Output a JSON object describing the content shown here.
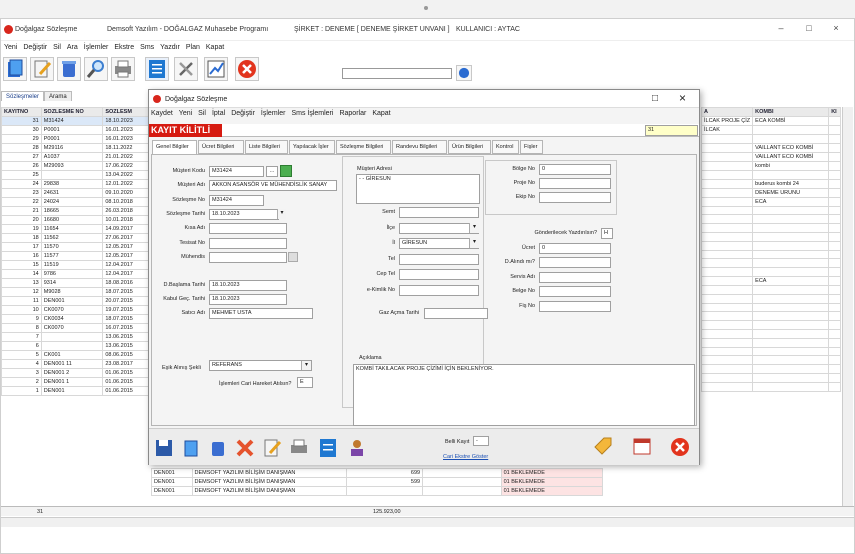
{
  "app": {
    "title_app": "Doğalgaz Sözleşme",
    "title_vendor": "Demsoft Yazılım - DOĞALGAZ Muhasebe Programı",
    "title_company": "ŞİRKET : DENEME [ DENEME ŞİRKET UNVANI ]",
    "title_user": "KULLANICI : AYTAC",
    "minimize": "–",
    "maximize": "□",
    "close": "×"
  },
  "menu": [
    "Yeni",
    "Değiştir",
    "Sil",
    "Ara",
    "İşlemler",
    "Ekstre",
    "Sms",
    "Yazdır",
    "Plan",
    "Kapat"
  ],
  "toolbar": {
    "icons": [
      "new-doc-icon",
      "edit-doc-icon",
      "delete-icon",
      "search-icon",
      "print-icon",
      "list-icon",
      "tools-icon",
      "chart-icon",
      "exit-icon"
    ],
    "search_value": ""
  },
  "left_tabs": [
    "Sözleşmeler",
    "Arama"
  ],
  "grid": {
    "headers": [
      "KAYITNO",
      "SOZLESME NO",
      "SOZLESM"
    ],
    "rows": [
      [
        "31",
        "M31424",
        "18.10.2023"
      ],
      [
        "30",
        "P0001",
        "16.01.2023"
      ],
      [
        "29",
        "P0001",
        "16.01.2023"
      ],
      [
        "28",
        "M29116",
        "18.11.2022"
      ],
      [
        "27",
        "A1037",
        "21.01.2022"
      ],
      [
        "26",
        "M29093",
        "17.06.2022"
      ],
      [
        "25",
        "",
        "13.04.2022"
      ],
      [
        "24",
        "29838",
        "12.01.2022"
      ],
      [
        "23",
        "24631",
        "09.10.2020"
      ],
      [
        "22",
        "24024",
        "08.10.2018"
      ],
      [
        "21",
        "18665",
        "26.03.2018"
      ],
      [
        "20",
        "16680",
        "10.01.2018"
      ],
      [
        "19",
        "11654",
        "14.09.2017"
      ],
      [
        "18",
        "11562",
        "27.06.2017"
      ],
      [
        "17",
        "11570",
        "12.05.2017"
      ],
      [
        "16",
        "11577",
        "12.05.2017"
      ],
      [
        "15",
        "11519",
        "12.04.2017"
      ],
      [
        "14",
        "9786",
        "12.04.2017"
      ],
      [
        "13",
        "9314",
        "18.08.2016"
      ],
      [
        "12",
        "M9028",
        "18.07.2015"
      ],
      [
        "11",
        "DEN001",
        "20.07.2015"
      ],
      [
        "10",
        "CK0070",
        "19.07.2015"
      ],
      [
        "9",
        "CK0034",
        "18.07.2015"
      ],
      [
        "8",
        "CK0070",
        "16.07.2015"
      ],
      [
        "7",
        "",
        "13.06.2015"
      ],
      [
        "6",
        "",
        "13.06.2015"
      ],
      [
        "5",
        "CK001",
        "08.06.2015"
      ],
      [
        "4",
        "DEN001 11",
        "23.08.2017"
      ],
      [
        "3",
        "DEN001 2",
        "01.06.2015"
      ],
      [
        "2",
        "DEN001 1",
        "01.06.2015"
      ],
      [
        "1",
        "DEN001",
        "01.06.2015"
      ]
    ],
    "bottom_rows": [
      [
        "DEN001",
        "DEMSOFT YAZILIM BİLİŞİM DANIŞMAN",
        "699",
        "",
        "01 BEKLEMEDE"
      ],
      [
        "DEN001",
        "DEMSOFT YAZILIM BİLİŞİM DANIŞMAN",
        "599",
        "",
        "01 BEKLEMEDE"
      ],
      [
        "DEN001",
        "DEMSOFT YAZILIM BİLİŞİM DANIŞMAN",
        "",
        "",
        "01 BEKLEMEDE"
      ]
    ],
    "right_headers": [
      "A",
      "KOMBI",
      "KI"
    ],
    "right_rows": [
      [
        "İLCAK PROJE ÇİZ",
        "ECA KOMBİ"
      ],
      [
        "İLCAK",
        ""
      ],
      [
        "",
        ""
      ],
      [
        "",
        "VAILLANT ECO KOMBİ"
      ],
      [
        "",
        "VAILLANT ECO KOMBİ"
      ],
      [
        "",
        "kombi"
      ],
      [
        "",
        ""
      ],
      [
        "",
        "buderus kombi 24"
      ],
      [
        "",
        "DENEME URUNU"
      ],
      [
        "",
        "ECA"
      ]
    ],
    "right_extra": [
      {
        "row": 18,
        "text": "ECA"
      }
    ],
    "total_count": "31",
    "total_amount": "125.923,00"
  },
  "dialog": {
    "title": "Doğalgaz Sözleşme",
    "menu": [
      "Kaydet",
      "Yeni",
      "Sil",
      "İptal",
      "Değiştir",
      "İşlemler",
      "Sms İşlemleri",
      "Raporlar",
      "Kapat"
    ],
    "banner": "KAYIT KİLİTLİ",
    "banner_right_value": "31",
    "tabs": [
      "Genel Bilgiler",
      "Ücret Bilgileri",
      "Liste Bilgileri",
      "Yapılacak İşler",
      "Sözleşme Bilgileri",
      "Randevu Bilgileri",
      "Ürün Bilgileri",
      "Kontrol",
      "Fişler"
    ],
    "left_fields": [
      {
        "label": "Müşteri Kodu",
        "value": "M31424"
      },
      {
        "label": "Müşteri Adı",
        "value": "AKKON ASANSÖR VE MÜHENDİSLİK SANAY"
      },
      {
        "label": "Sözleşme No",
        "value": "M31424"
      },
      {
        "label": "Sözleşme Tarihi",
        "value": "18.10.2023"
      },
      {
        "label": "Kısa Adı",
        "value": ""
      },
      {
        "label": "Tesisat No",
        "value": ""
      },
      {
        "label": "Mühendis",
        "value": ""
      }
    ],
    "date_fields": [
      {
        "label": "D.Başlama Tarihi",
        "value": "18.10.2023"
      },
      {
        "label": "Kabul Geç. Tarihi",
        "value": "18.10.2023"
      },
      {
        "label": "Satıcı Adı",
        "value": "MEHMET USTA"
      }
    ],
    "address_label": "Müşteri Adresi",
    "address_value": "- - GİRESUN",
    "mid_fields": [
      {
        "label": "Semt",
        "value": ""
      },
      {
        "label": "İlçe",
        "value": ""
      },
      {
        "label": "İl",
        "value": "GİRESUN"
      },
      {
        "label": "Tel",
        "value": ""
      },
      {
        "label": "Cep Tel",
        "value": ""
      },
      {
        "label": "e-Kimlik No",
        "value": ""
      },
      {
        "label": "Gaz Açma Tarihi",
        "value": ""
      }
    ],
    "right_fields": [
      {
        "label": "Bölge No",
        "value": "0"
      },
      {
        "label": "Proje No",
        "value": ""
      },
      {
        "label": "Ekip No",
        "value": ""
      }
    ],
    "right2_fields": [
      {
        "label": "Gönderilecek Yazdırılsın?",
        "value": "H"
      },
      {
        "label": "Ücret",
        "value": "0"
      },
      {
        "label": "D.Alındı mı?",
        "value": ""
      },
      {
        "label": "Servis Adı",
        "value": ""
      },
      {
        "label": "Belge No",
        "value": ""
      },
      {
        "label": "Fiş No",
        "value": ""
      }
    ],
    "status_label": "Eşik Alınış Şekli",
    "status_value": "REFERANS",
    "cycle_label": "İşlemleri Cari Hareket Atılsın?",
    "cycle_value": "E",
    "note_label": "Açıklama",
    "note_value": "KOMBİ TAKILACAK PROJE ÇİZİMİ İÇİN BEKLENİYOR.",
    "bottom_toolbar": [
      "save-icon",
      "new-icon",
      "delete-icon",
      "cancel-icon",
      "edit-icon",
      "print-icon",
      "list-icon",
      "user-icon"
    ],
    "footer_label": "Belli Kayıt",
    "footer_link": "Cari Ekstre Göster",
    "footer_select": "-"
  }
}
